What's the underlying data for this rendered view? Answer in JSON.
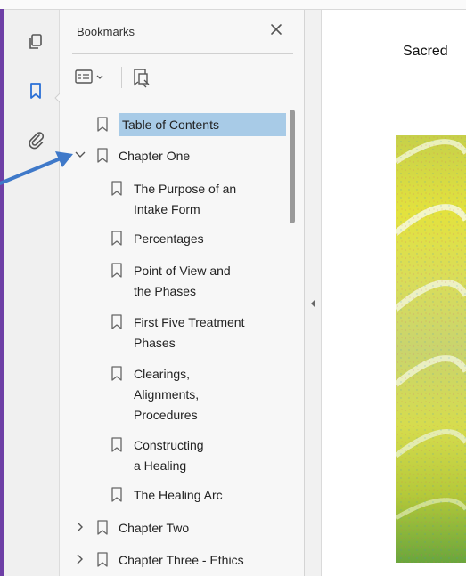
{
  "panel": {
    "title": "Bookmarks",
    "close_icon": "close-icon"
  },
  "rail": {
    "icons": [
      "copy-pages-icon",
      "bookmark-icon",
      "paperclip-icon"
    ],
    "active": "bookmark-icon"
  },
  "toolbar": {
    "options_icon": "bookmark-options-icon",
    "new_bookmark_icon": "new-bookmark-icon"
  },
  "bookmarks": [
    {
      "label": "Table of Contents",
      "level": 0,
      "selected": true
    },
    {
      "label": "Chapter One",
      "level": 0,
      "expanded": true
    },
    {
      "label": "The Purpose of an",
      "label2": "Intake Form",
      "level": 1
    },
    {
      "label": "Percentages",
      "level": 1
    },
    {
      "label": "Point of View and",
      "label2": "the Phases",
      "level": 1
    },
    {
      "label": "First Five Treatment",
      "label2": "Phases",
      "level": 1
    },
    {
      "label": "Clearings,",
      "label2": "Alignments,",
      "label3": "Procedures",
      "level": 1
    },
    {
      "label": "Constructing",
      "label2": "a Healing",
      "level": 1
    },
    {
      "label": "The Healing Arc",
      "level": 1
    },
    {
      "label": "Chapter Two",
      "level": 0,
      "expanded": false
    },
    {
      "label": "Chapter Three - Ethics",
      "level": 0,
      "expanded": false
    }
  ],
  "document": {
    "title": "Sacred"
  },
  "colors": {
    "accent_arrow": "#3f79c9",
    "selection": "#a8cbe7",
    "rail_active": "#2a6fd6"
  }
}
